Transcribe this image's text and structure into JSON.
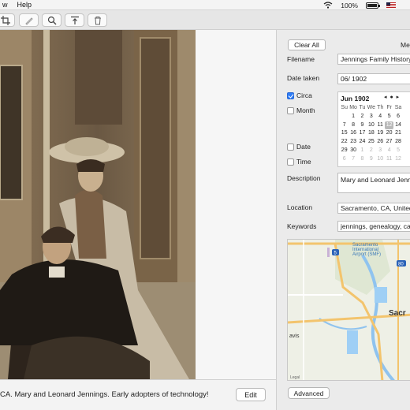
{
  "menubar": {
    "items": [
      "w",
      "Help"
    ],
    "battery_percent": "100%"
  },
  "caption": {
    "text": "CA. Mary and Leonard Jennings. Early adopters of technology!",
    "edit_label": "Edit"
  },
  "panel": {
    "clear_all_label": "Clear All",
    "meta_label": "Met",
    "filename_label": "Filename",
    "filename_value": "Jennings Family History",
    "date_taken_label": "Date taken",
    "date_taken_value": "06/ 1902",
    "circa_label": "Circa",
    "circa_checked": true,
    "month_label": "Month",
    "date_label": "Date",
    "time_label": "Time",
    "calendar": {
      "title": "Jun 1902",
      "nav": "◂ ● ▸",
      "weekdays": [
        "Su",
        "Mo",
        "Tu",
        "We",
        "Th",
        "Fr",
        "Sa"
      ],
      "selected_day": "12"
    },
    "description_label": "Description",
    "description_value": "Mary and Leonard Jenni",
    "location_label": "Location",
    "location_value": "Sacramento, CA, United S",
    "keywords_label": "Keywords",
    "keywords_value": "jennings, genealogy, cal",
    "map": {
      "airport_label_1": "Sacramento",
      "airport_label_2": "International",
      "airport_label_3": "Airport (SMF)",
      "city_label": "Sacr",
      "town_label": "avis",
      "highway_5": "5",
      "highway_80": "80",
      "legal": "Legal"
    },
    "advanced_label": "Advanced"
  },
  "colors": {
    "accent": "#2e7cf6",
    "panel_bg": "#ebebeb"
  }
}
